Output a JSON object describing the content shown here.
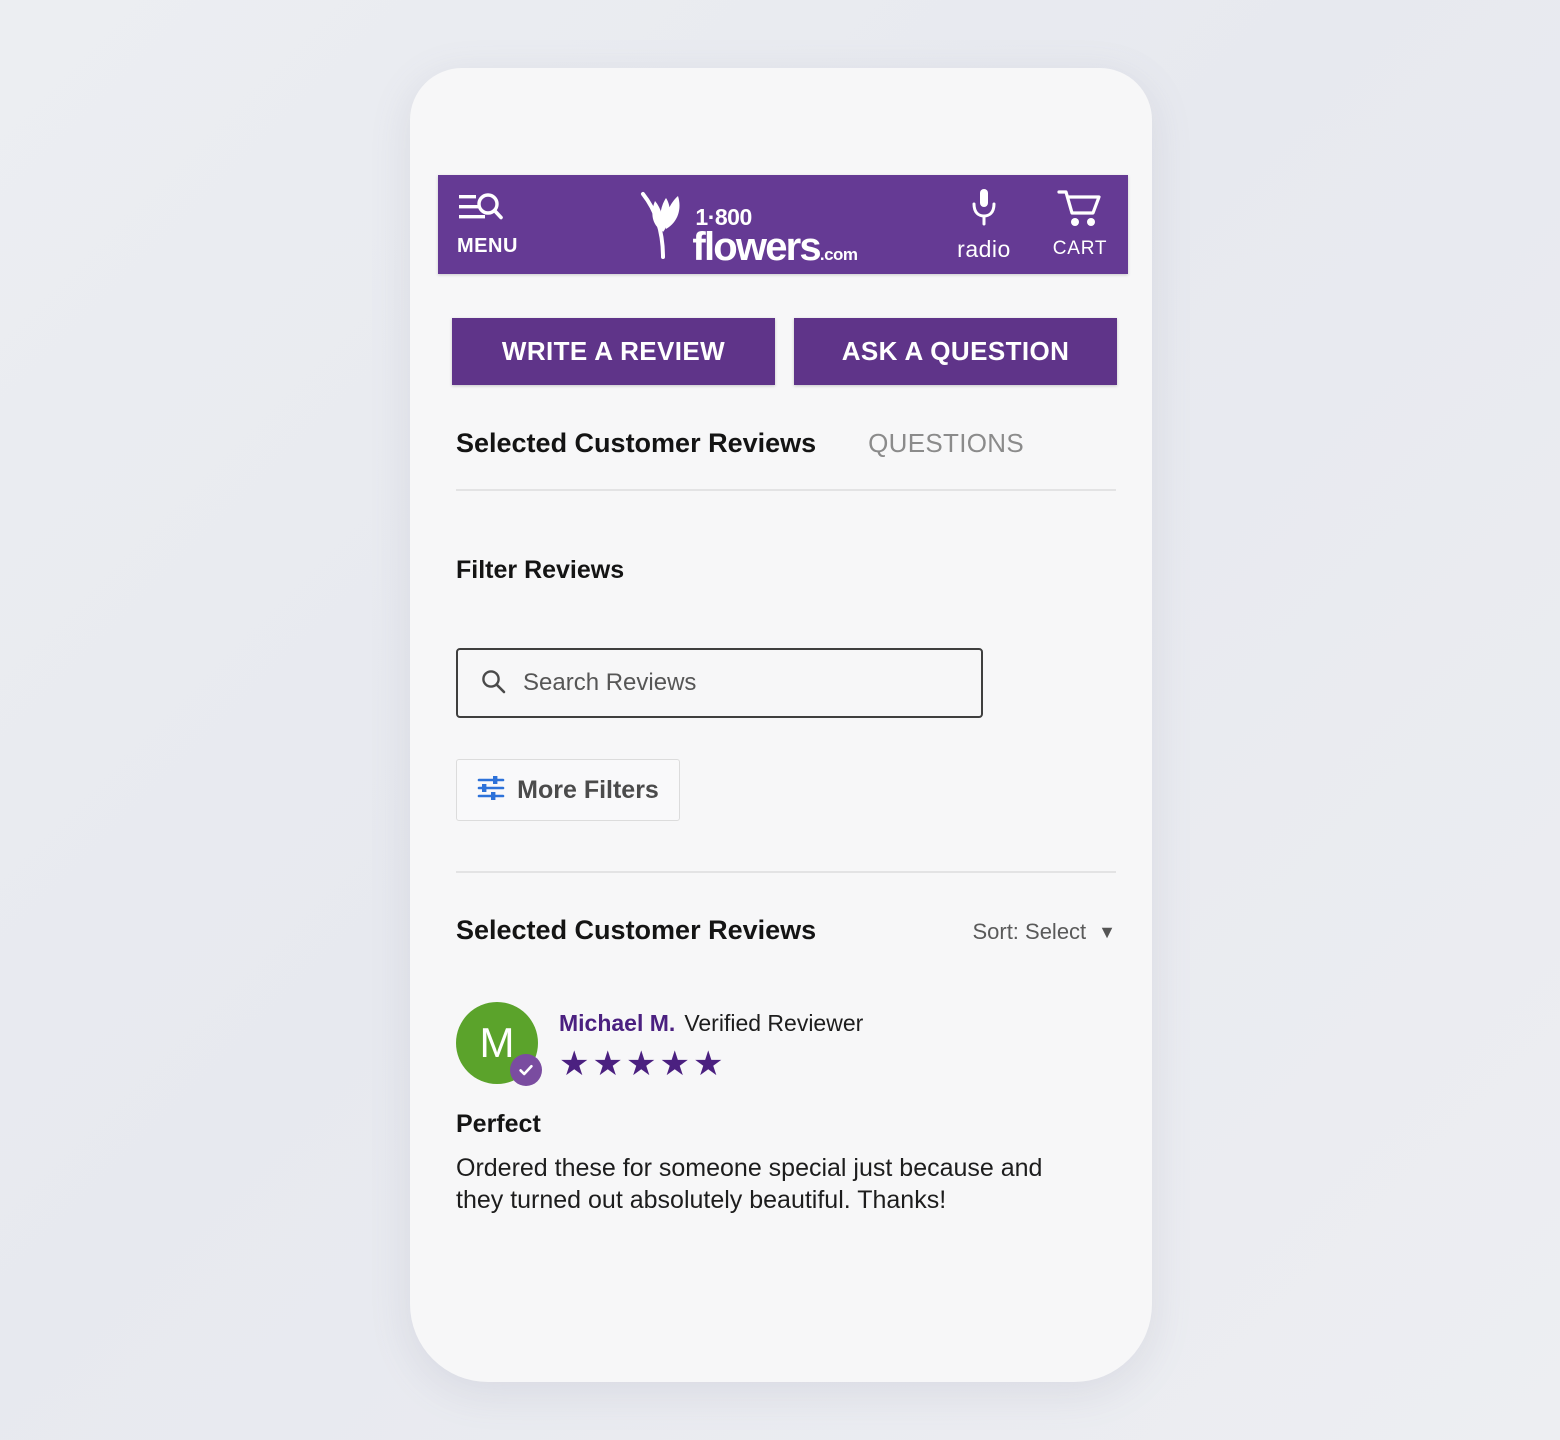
{
  "theme": {
    "header_purple": "#653a94",
    "button_purple": "#5f3489",
    "star_purple": "#4b2080",
    "avatar_green": "#5ba32b",
    "badge_purple": "#7a4ca0",
    "filter_icon_blue": "#2d72d9",
    "page_background": "#e8e9ee"
  },
  "header": {
    "menu_label": "MENU",
    "menu_icon": "menu-search-icon",
    "logo": {
      "icon": "tulip-flower-icon",
      "phone": "1·800",
      "name": "flowers",
      "tld": ".com"
    },
    "radio": {
      "icon": "microphone-icon",
      "label": "radio"
    },
    "cart": {
      "icon": "shopping-cart-icon",
      "label": "CART"
    }
  },
  "actions": {
    "write_review": "WRITE A REVIEW",
    "ask_question": "ASK A QUESTION"
  },
  "tabs": [
    {
      "label": "Selected Customer Reviews",
      "active": true
    },
    {
      "label": "QUESTIONS",
      "active": false
    }
  ],
  "filters": {
    "heading": "Filter Reviews",
    "search": {
      "icon": "search-icon",
      "placeholder": "Search Reviews",
      "value": ""
    },
    "more_filters": {
      "icon": "sliders-icon",
      "label": "More Filters"
    }
  },
  "reviews_section": {
    "heading": "Selected Customer Reviews",
    "sort": {
      "label": "Sort: Select",
      "caret": "▼"
    }
  },
  "review": {
    "avatar_initial": "M",
    "verified_badge_icon": "check-circle-icon",
    "reviewer_name": "Michael M.",
    "verified_label": "Verified Reviewer",
    "rating": 5,
    "rating_max": 5,
    "star_glyph": "★",
    "title": "Perfect",
    "body": "Ordered these for someone special just because and they turned out absolutely beautiful. Thanks!"
  }
}
